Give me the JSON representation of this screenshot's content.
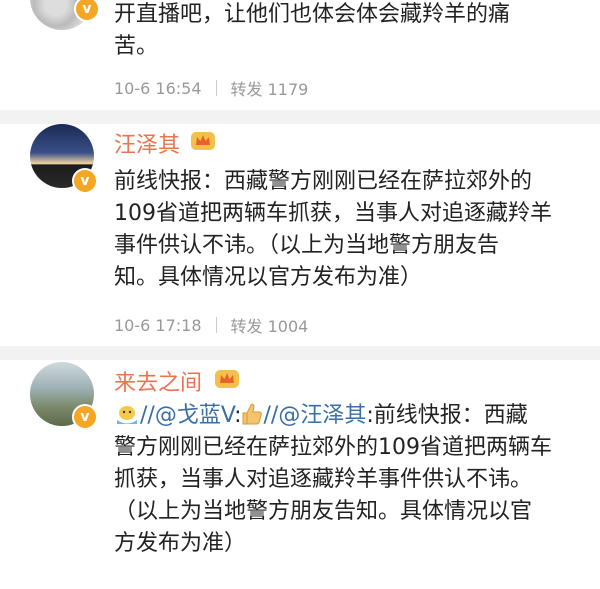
{
  "posts": [
    {
      "text_lines": [
        "开直播吧，让他们也体会体会藏羚羊的痛",
        "苦。"
      ],
      "time": "10-6 16:54",
      "repost": "转发 1179"
    },
    {
      "username": "汪泽其",
      "text_lines": [
        "前线快报：西藏警方刚刚已经在萨拉郊外的",
        "109省道把两辆车抓获，当事人对追逐藏羚羊",
        "事件供认不讳。（以上为当地警方朋友告",
        "知。具体情况以官方发布为准）"
      ],
      "time": "10-6 17:18",
      "repost": "转发 1004"
    },
    {
      "username": "来去之间",
      "repost_prefix": "//",
      "mention1": "@戈蓝V",
      "colon1": ":",
      "sep2": "//",
      "mention2": "@汪泽其",
      "line1_rest": ":前线快报：西藏",
      "text_lines": [
        "警方刚刚已经在萨拉郊外的109省道把两辆车",
        "抓获，当事人对追逐藏羚羊事件供认不讳。",
        "（以上为当地警方朋友告知。具体情况以官",
        "方发布为准）"
      ]
    }
  ],
  "badge_symbol": "v",
  "colors": {
    "username": "#eb7350",
    "link": "#3a6ea5",
    "meta": "#999999",
    "badge": "#f5a623"
  }
}
